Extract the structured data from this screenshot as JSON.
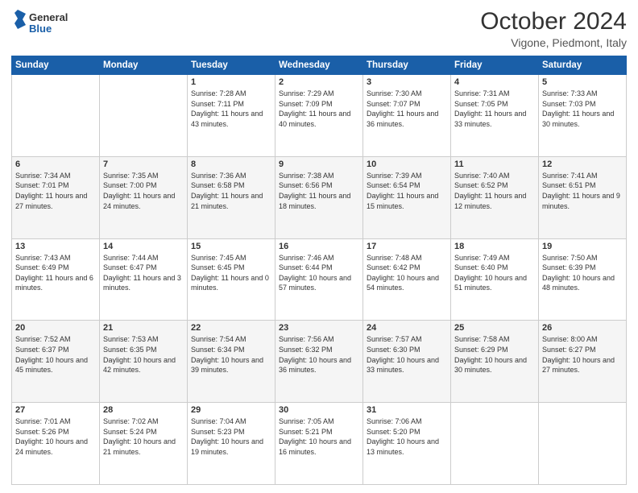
{
  "header": {
    "logo_line1": "General",
    "logo_line2": "Blue",
    "month": "October 2024",
    "location": "Vigone, Piedmont, Italy"
  },
  "days_of_week": [
    "Sunday",
    "Monday",
    "Tuesday",
    "Wednesday",
    "Thursday",
    "Friday",
    "Saturday"
  ],
  "weeks": [
    [
      {
        "day": "",
        "sunrise": "",
        "sunset": "",
        "daylight": ""
      },
      {
        "day": "",
        "sunrise": "",
        "sunset": "",
        "daylight": ""
      },
      {
        "day": "1",
        "sunrise": "Sunrise: 7:28 AM",
        "sunset": "Sunset: 7:11 PM",
        "daylight": "Daylight: 11 hours and 43 minutes."
      },
      {
        "day": "2",
        "sunrise": "Sunrise: 7:29 AM",
        "sunset": "Sunset: 7:09 PM",
        "daylight": "Daylight: 11 hours and 40 minutes."
      },
      {
        "day": "3",
        "sunrise": "Sunrise: 7:30 AM",
        "sunset": "Sunset: 7:07 PM",
        "daylight": "Daylight: 11 hours and 36 minutes."
      },
      {
        "day": "4",
        "sunrise": "Sunrise: 7:31 AM",
        "sunset": "Sunset: 7:05 PM",
        "daylight": "Daylight: 11 hours and 33 minutes."
      },
      {
        "day": "5",
        "sunrise": "Sunrise: 7:33 AM",
        "sunset": "Sunset: 7:03 PM",
        "daylight": "Daylight: 11 hours and 30 minutes."
      }
    ],
    [
      {
        "day": "6",
        "sunrise": "Sunrise: 7:34 AM",
        "sunset": "Sunset: 7:01 PM",
        "daylight": "Daylight: 11 hours and 27 minutes."
      },
      {
        "day": "7",
        "sunrise": "Sunrise: 7:35 AM",
        "sunset": "Sunset: 7:00 PM",
        "daylight": "Daylight: 11 hours and 24 minutes."
      },
      {
        "day": "8",
        "sunrise": "Sunrise: 7:36 AM",
        "sunset": "Sunset: 6:58 PM",
        "daylight": "Daylight: 11 hours and 21 minutes."
      },
      {
        "day": "9",
        "sunrise": "Sunrise: 7:38 AM",
        "sunset": "Sunset: 6:56 PM",
        "daylight": "Daylight: 11 hours and 18 minutes."
      },
      {
        "day": "10",
        "sunrise": "Sunrise: 7:39 AM",
        "sunset": "Sunset: 6:54 PM",
        "daylight": "Daylight: 11 hours and 15 minutes."
      },
      {
        "day": "11",
        "sunrise": "Sunrise: 7:40 AM",
        "sunset": "Sunset: 6:52 PM",
        "daylight": "Daylight: 11 hours and 12 minutes."
      },
      {
        "day": "12",
        "sunrise": "Sunrise: 7:41 AM",
        "sunset": "Sunset: 6:51 PM",
        "daylight": "Daylight: 11 hours and 9 minutes."
      }
    ],
    [
      {
        "day": "13",
        "sunrise": "Sunrise: 7:43 AM",
        "sunset": "Sunset: 6:49 PM",
        "daylight": "Daylight: 11 hours and 6 minutes."
      },
      {
        "day": "14",
        "sunrise": "Sunrise: 7:44 AM",
        "sunset": "Sunset: 6:47 PM",
        "daylight": "Daylight: 11 hours and 3 minutes."
      },
      {
        "day": "15",
        "sunrise": "Sunrise: 7:45 AM",
        "sunset": "Sunset: 6:45 PM",
        "daylight": "Daylight: 11 hours and 0 minutes."
      },
      {
        "day": "16",
        "sunrise": "Sunrise: 7:46 AM",
        "sunset": "Sunset: 6:44 PM",
        "daylight": "Daylight: 10 hours and 57 minutes."
      },
      {
        "day": "17",
        "sunrise": "Sunrise: 7:48 AM",
        "sunset": "Sunset: 6:42 PM",
        "daylight": "Daylight: 10 hours and 54 minutes."
      },
      {
        "day": "18",
        "sunrise": "Sunrise: 7:49 AM",
        "sunset": "Sunset: 6:40 PM",
        "daylight": "Daylight: 10 hours and 51 minutes."
      },
      {
        "day": "19",
        "sunrise": "Sunrise: 7:50 AM",
        "sunset": "Sunset: 6:39 PM",
        "daylight": "Daylight: 10 hours and 48 minutes."
      }
    ],
    [
      {
        "day": "20",
        "sunrise": "Sunrise: 7:52 AM",
        "sunset": "Sunset: 6:37 PM",
        "daylight": "Daylight: 10 hours and 45 minutes."
      },
      {
        "day": "21",
        "sunrise": "Sunrise: 7:53 AM",
        "sunset": "Sunset: 6:35 PM",
        "daylight": "Daylight: 10 hours and 42 minutes."
      },
      {
        "day": "22",
        "sunrise": "Sunrise: 7:54 AM",
        "sunset": "Sunset: 6:34 PM",
        "daylight": "Daylight: 10 hours and 39 minutes."
      },
      {
        "day": "23",
        "sunrise": "Sunrise: 7:56 AM",
        "sunset": "Sunset: 6:32 PM",
        "daylight": "Daylight: 10 hours and 36 minutes."
      },
      {
        "day": "24",
        "sunrise": "Sunrise: 7:57 AM",
        "sunset": "Sunset: 6:30 PM",
        "daylight": "Daylight: 10 hours and 33 minutes."
      },
      {
        "day": "25",
        "sunrise": "Sunrise: 7:58 AM",
        "sunset": "Sunset: 6:29 PM",
        "daylight": "Daylight: 10 hours and 30 minutes."
      },
      {
        "day": "26",
        "sunrise": "Sunrise: 8:00 AM",
        "sunset": "Sunset: 6:27 PM",
        "daylight": "Daylight: 10 hours and 27 minutes."
      }
    ],
    [
      {
        "day": "27",
        "sunrise": "Sunrise: 7:01 AM",
        "sunset": "Sunset: 5:26 PM",
        "daylight": "Daylight: 10 hours and 24 minutes."
      },
      {
        "day": "28",
        "sunrise": "Sunrise: 7:02 AM",
        "sunset": "Sunset: 5:24 PM",
        "daylight": "Daylight: 10 hours and 21 minutes."
      },
      {
        "day": "29",
        "sunrise": "Sunrise: 7:04 AM",
        "sunset": "Sunset: 5:23 PM",
        "daylight": "Daylight: 10 hours and 19 minutes."
      },
      {
        "day": "30",
        "sunrise": "Sunrise: 7:05 AM",
        "sunset": "Sunset: 5:21 PM",
        "daylight": "Daylight: 10 hours and 16 minutes."
      },
      {
        "day": "31",
        "sunrise": "Sunrise: 7:06 AM",
        "sunset": "Sunset: 5:20 PM",
        "daylight": "Daylight: 10 hours and 13 minutes."
      },
      {
        "day": "",
        "sunrise": "",
        "sunset": "",
        "daylight": ""
      },
      {
        "day": "",
        "sunrise": "",
        "sunset": "",
        "daylight": ""
      }
    ]
  ]
}
